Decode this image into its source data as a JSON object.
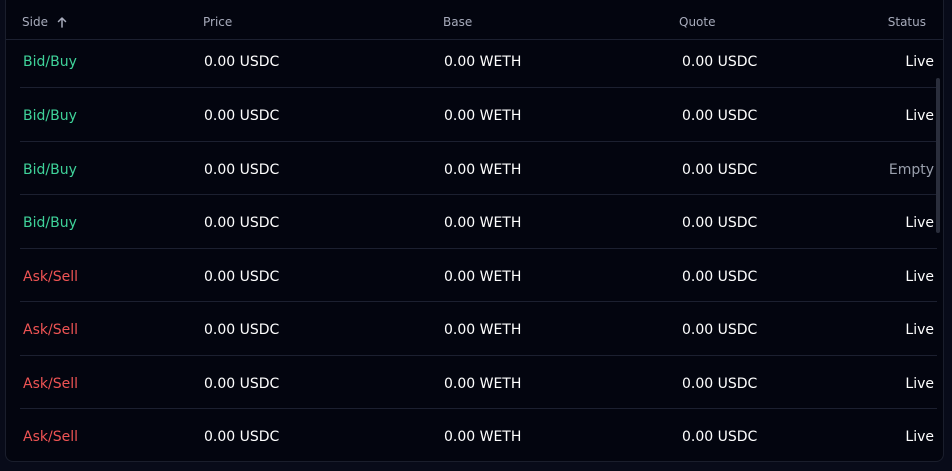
{
  "table": {
    "headers": {
      "side": "Side",
      "price": "Price",
      "base": "Base",
      "quote": "Quote",
      "status": "Status"
    },
    "sort_icon": "arrow-up-icon",
    "rows": [
      {
        "side": "Bid/Buy",
        "side_type": "buy",
        "price": "0.00 USDC",
        "base": "0.00 WETH",
        "quote": "0.00 USDC",
        "status": "Live"
      },
      {
        "side": "Bid/Buy",
        "side_type": "buy",
        "price": "0.00 USDC",
        "base": "0.00 WETH",
        "quote": "0.00 USDC",
        "status": "Live"
      },
      {
        "side": "Bid/Buy",
        "side_type": "buy",
        "price": "0.00 USDC",
        "base": "0.00 WETH",
        "quote": "0.00 USDC",
        "status": "Empty"
      },
      {
        "side": "Bid/Buy",
        "side_type": "buy",
        "price": "0.00 USDC",
        "base": "0.00 WETH",
        "quote": "0.00 USDC",
        "status": "Live"
      },
      {
        "side": "Ask/Sell",
        "side_type": "sell",
        "price": "0.00 USDC",
        "base": "0.00 WETH",
        "quote": "0.00 USDC",
        "status": "Live"
      },
      {
        "side": "Ask/Sell",
        "side_type": "sell",
        "price": "0.00 USDC",
        "base": "0.00 WETH",
        "quote": "0.00 USDC",
        "status": "Live"
      },
      {
        "side": "Ask/Sell",
        "side_type": "sell",
        "price": "0.00 USDC",
        "base": "0.00 WETH",
        "quote": "0.00 USDC",
        "status": "Live"
      },
      {
        "side": "Ask/Sell",
        "side_type": "sell",
        "price": "0.00 USDC",
        "base": "0.00 WETH",
        "quote": "0.00 USDC",
        "status": "Live"
      }
    ]
  },
  "colors": {
    "buy": "#3fd39a",
    "sell": "#ef5454",
    "background": "#03050f"
  }
}
